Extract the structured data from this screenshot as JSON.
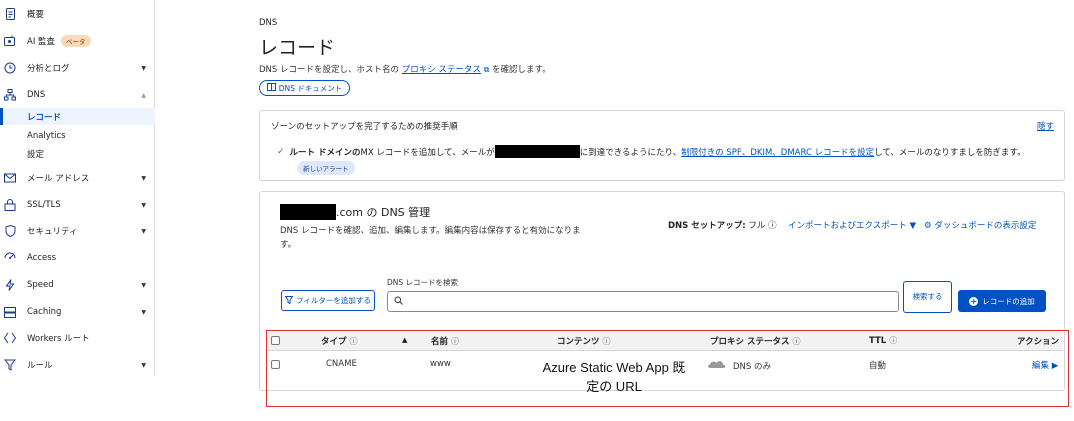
{
  "sidebar": {
    "items": [
      {
        "label": "概要",
        "icon": "document-icon"
      },
      {
        "label": "AI 監査",
        "icon": "ai-audit-icon",
        "badge": "ベータ"
      },
      {
        "label": "分析とログ",
        "icon": "clock-chart-icon"
      },
      {
        "label": "DNS",
        "icon": "network-icon",
        "subitems": [
          {
            "label": "レコード",
            "active": true
          },
          {
            "label": "Analytics"
          },
          {
            "label": "設定"
          }
        ]
      },
      {
        "label": "メール アドレス",
        "icon": "email-icon"
      },
      {
        "label": "SSL/TLS",
        "icon": "lock-icon"
      },
      {
        "label": "セキュリティ",
        "icon": "shield-icon"
      },
      {
        "label": "Access",
        "icon": "access-icon"
      },
      {
        "label": "Speed",
        "icon": "lightning-icon"
      },
      {
        "label": "Caching",
        "icon": "server-icon"
      },
      {
        "label": "Workers ルート",
        "icon": "workers-icon"
      },
      {
        "label": "ルール",
        "icon": "rules-icon"
      }
    ]
  },
  "header": {
    "breadcrumb": "DNS",
    "title": "レコード",
    "desc_before": "DNS レコードを設定し、ホスト名の ",
    "desc_link": "プロキシ ステータス",
    "desc_after": " を確認します。",
    "doc_button": "DNS ドキュメント"
  },
  "setup_card": {
    "title": "ゾーンのセットアップを完了するための推奨手順",
    "hide_link": "隠す",
    "bold_text": "ルート ドメインの",
    "text1": " MX レコードを追加して、メールが",
    "text2": "に到達できるようにたり、",
    "link": "制限付きの SPF、DKIM、DMARC レコードを設定",
    "text3": "して、メールのなりすましを防ぎます。",
    "badge": "新しいアラート"
  },
  "mgmt_card": {
    "title_suffix": ".com の DNS 管理",
    "desc": "DNS レコードを確認、追加、編集します。編集内容は保存すると有効になります。",
    "setup_label": "DNS セットアップ:",
    "setup_value": "フル",
    "import_export": "インポートおよびエクスポート",
    "dashboard_settings": "ダッシュボードの表示設定",
    "filter_button": "フィルターを追加する",
    "search_label": "DNS レコードを検索",
    "search_placeholder": "",
    "search_button": "検索する",
    "add_button": "レコードの追加"
  },
  "table": {
    "columns": [
      "タイプ",
      "名前",
      "コンテンツ",
      "プロキシ ステータス",
      "TTL",
      "アクション"
    ],
    "rows": [
      {
        "type": "CNAME",
        "name": "www",
        "content": "Azure Static Web App 既定の URL",
        "proxy": "DNS のみ",
        "ttl": "自動",
        "action": "編集"
      }
    ]
  },
  "colors": {
    "accent": "#0051c3",
    "highlight": "#e03030"
  }
}
